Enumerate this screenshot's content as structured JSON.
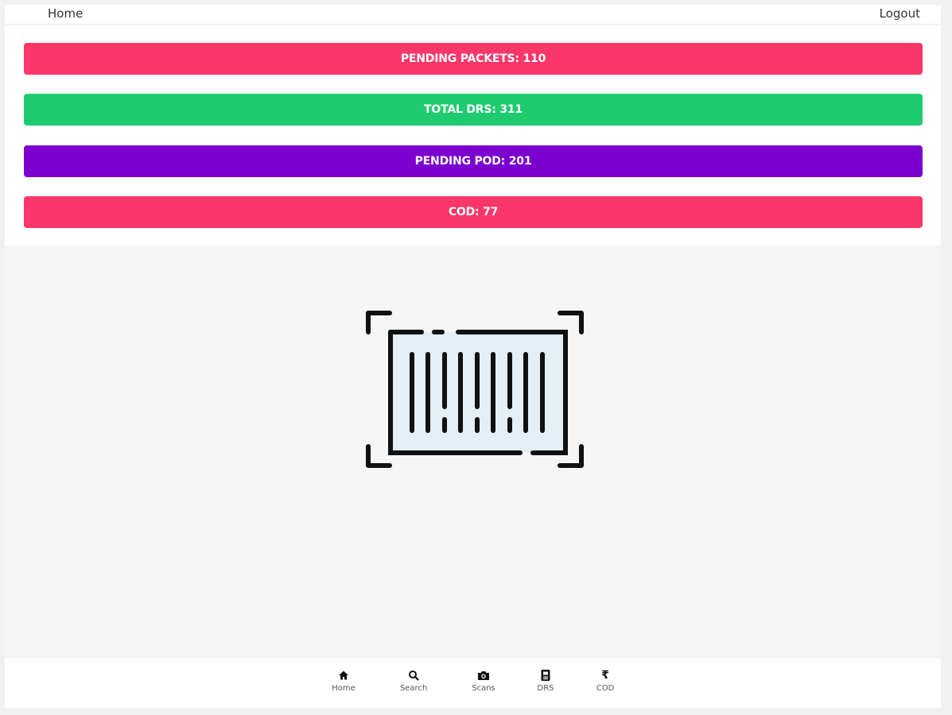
{
  "header": {
    "home_label": "Home",
    "logout_label": "Logout"
  },
  "stats": [
    {
      "label": "PENDING PACKETS: 110",
      "color": "#fb3669"
    },
    {
      "label": "TOTAL DRS: 311",
      "color": "#1ecb6e"
    },
    {
      "label": "PENDING POD: 201",
      "color": "#7b00cf"
    },
    {
      "label": "COD: 77",
      "color": "#fb3669"
    }
  ],
  "hero": {
    "icon": "barcode-scan-icon"
  },
  "bottom_nav": [
    {
      "label": "Home",
      "icon": "home-icon"
    },
    {
      "label": "Search",
      "icon": "search-icon"
    },
    {
      "label": "Scans",
      "icon": "camera-icon"
    },
    {
      "label": "DRS",
      "icon": "document-icon"
    },
    {
      "label": "COD",
      "icon": "rupee-icon"
    }
  ]
}
